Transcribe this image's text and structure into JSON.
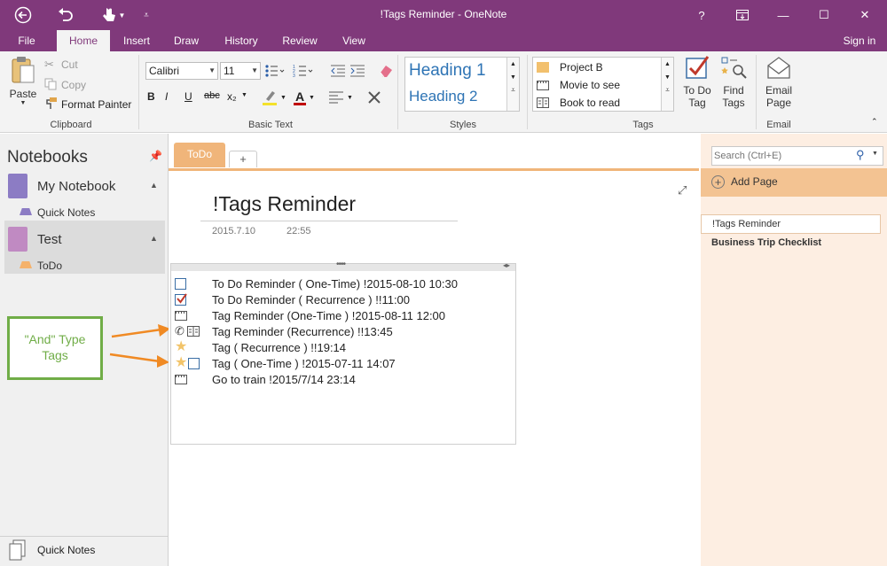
{
  "window": {
    "title": "!Tags Reminder - OneNote",
    "help": "?",
    "minimize": "—",
    "maximize": "☐",
    "close": "✕"
  },
  "ribbon_tabs": [
    "File",
    "Home",
    "Insert",
    "Draw",
    "History",
    "Review",
    "View"
  ],
  "sign_in": "Sign in",
  "clipboard": {
    "paste": "Paste",
    "cut": "Cut",
    "copy": "Copy",
    "format_painter": "Format Painter",
    "group": "Clipboard"
  },
  "basic_text": {
    "font": "Calibri",
    "size": "11",
    "bold": "B",
    "italic": "I",
    "underline": "U",
    "strike": "abc",
    "subscript": "x₂",
    "font_color": "A",
    "group": "Basic Text"
  },
  "styles": {
    "h1": "Heading 1",
    "h2": "Heading 2",
    "group": "Styles"
  },
  "tags": {
    "items": [
      "Project B",
      "Movie to see",
      "Book to read"
    ],
    "group": "Tags",
    "todo_line1": "To Do",
    "todo_line2": "Tag",
    "find_line1": "Find",
    "find_line2": "Tags"
  },
  "email": {
    "line1": "Email",
    "line2": "Page",
    "group": "Email"
  },
  "nav": {
    "header": "Notebooks",
    "notebooks": [
      {
        "name": "My Notebook",
        "color": "#8c7cc4",
        "section": "Quick Notes",
        "section_color": "#8c7cc4"
      },
      {
        "name": "Test",
        "color": "#c08ac2",
        "section": "ToDo",
        "section_color": "#f5b26b"
      }
    ],
    "bottom": "Quick Notes"
  },
  "section_tabs": {
    "active": "ToDo",
    "add": "+"
  },
  "search": {
    "placeholder": "Search (Ctrl+E)"
  },
  "page": {
    "title": "!Tags Reminder",
    "date": "2015.7.10",
    "time": "22:55",
    "rows": [
      {
        "icons": [
          "checkbox"
        ],
        "text": "To Do Reminder ( One-Time) !2015-08-10 10:30"
      },
      {
        "icons": [
          "checkbox-checked"
        ],
        "text": "To Do Reminder ( Recurrence ) !!11:00"
      },
      {
        "icons": [
          "film"
        ],
        "text": "Tag Reminder (One-Time ) !2015-08-11 12:00"
      },
      {
        "icons": [
          "phone",
          "book"
        ],
        "text": "Tag Reminder (Recurrence) !!13:45"
      },
      {
        "icons": [
          "star"
        ],
        "text": "Tag ( Recurrence ) !!19:14"
      },
      {
        "icons": [
          "star",
          "checkbox"
        ],
        "text": "Tag ( One-Time ) !2015-07-11 14:07"
      },
      {
        "icons": [
          "film"
        ],
        "text": "Go to train !2015/7/14 23:14"
      }
    ]
  },
  "callout": {
    "text_line1": "\"And\" Type",
    "text_line2": "Tags",
    "border_color": "#70ad47",
    "text_color": "#70ad47",
    "arrow_color": "#f08a24"
  },
  "pagelist": {
    "add_page": "Add Page",
    "pages": [
      "!Tags Reminder",
      "Business Trip Checklist"
    ]
  },
  "colors": {
    "accent": "#80397b",
    "section_orange": "#f0b57a",
    "pane_bg": "#fdeee2"
  }
}
